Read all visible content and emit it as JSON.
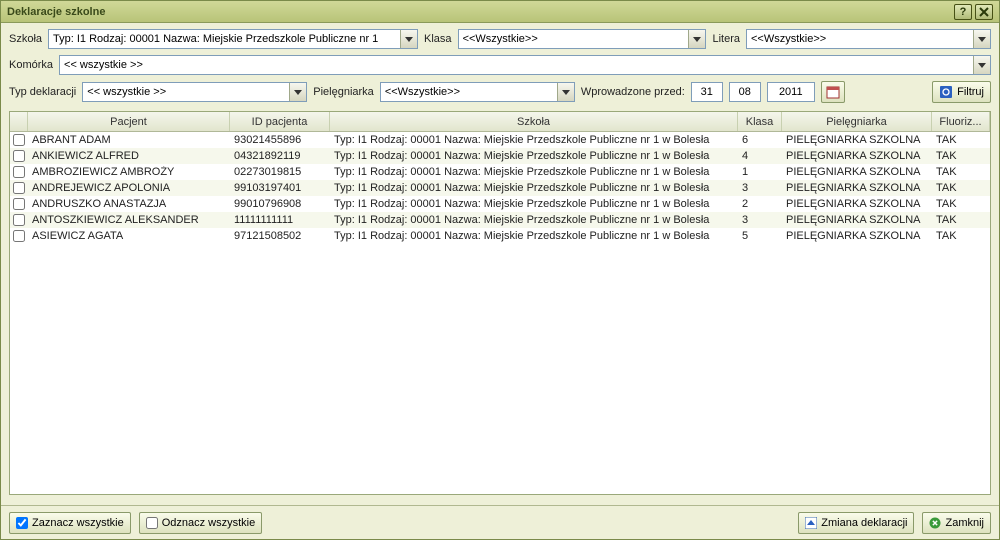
{
  "title": "Deklaracje szkolne",
  "filters": {
    "szkola_label": "Szkoła",
    "szkola_value": "Typ: I1 Rodzaj: 00001 Nazwa: Miejskie Przedszkole Publiczne nr 1",
    "klasa_label": "Klasa",
    "klasa_value": "<<Wszystkie>>",
    "litera_label": "Litera",
    "litera_value": "<<Wszystkie>>",
    "komorka_label": "Komórka",
    "komorka_value": "<< wszystkie >>",
    "typdek_label": "Typ deklaracji",
    "typdek_value": "<< wszystkie >>",
    "pieleg_label": "Pielęgniarka",
    "pieleg_value": "<<Wszystkie>>",
    "wprow_label": "Wprowadzone przed:",
    "day": "31",
    "month": "08",
    "year": "2011",
    "filtruj_label": "Filtruj"
  },
  "columns": {
    "pacjent": "Pacjent",
    "idpac": "ID pacjenta",
    "szkola": "Szkoła",
    "klasa": "Klasa",
    "pieleg": "Pielęgniarka",
    "fluor": "Fluoriz..."
  },
  "rows": [
    {
      "pacjent": "ABRANT ADAM",
      "id": "93021455896",
      "szkola": "Typ: I1 Rodzaj: 00001 Nazwa: Miejskie Przedszkole Publiczne nr 1 w Bolesła",
      "klasa": "6",
      "pieleg": "PIELĘGNIARKA SZKOLNA",
      "fluor": "TAK"
    },
    {
      "pacjent": "ANKIEWICZ ALFRED",
      "id": "04321892119",
      "szkola": "Typ: I1 Rodzaj: 00001 Nazwa: Miejskie Przedszkole Publiczne nr 1 w Bolesła",
      "klasa": "4",
      "pieleg": "PIELĘGNIARKA SZKOLNA",
      "fluor": "TAK"
    },
    {
      "pacjent": "AMBROZIEWICZ AMBROŻY",
      "id": "02273019815",
      "szkola": "Typ: I1 Rodzaj: 00001 Nazwa: Miejskie Przedszkole Publiczne nr 1 w Bolesła",
      "klasa": "1",
      "pieleg": "PIELĘGNIARKA SZKOLNA",
      "fluor": "TAK"
    },
    {
      "pacjent": "ANDREJEWICZ APOLONIA",
      "id": "99103197401",
      "szkola": "Typ: I1 Rodzaj: 00001 Nazwa: Miejskie Przedszkole Publiczne nr 1 w Bolesła",
      "klasa": "3",
      "pieleg": "PIELĘGNIARKA SZKOLNA",
      "fluor": "TAK"
    },
    {
      "pacjent": "ANDRUSZKO ANASTAZJA",
      "id": "99010796908",
      "szkola": "Typ: I1 Rodzaj: 00001 Nazwa: Miejskie Przedszkole Publiczne nr 1 w Bolesła",
      "klasa": "2",
      "pieleg": "PIELĘGNIARKA SZKOLNA",
      "fluor": "TAK"
    },
    {
      "pacjent": "ANTOSZKIEWICZ ALEKSANDER",
      "id": "11111111111",
      "szkola": "Typ: I1 Rodzaj: 00001 Nazwa: Miejskie Przedszkole Publiczne nr 1 w Bolesła",
      "klasa": "3",
      "pieleg": "PIELĘGNIARKA SZKOLNA",
      "fluor": "TAK"
    },
    {
      "pacjent": "ASIEWICZ AGATA",
      "id": "97121508502",
      "szkola": "Typ: I1 Rodzaj: 00001 Nazwa: Miejskie Przedszkole Publiczne nr 1 w Bolesła",
      "klasa": "5",
      "pieleg": "PIELĘGNIARKA SZKOLNA",
      "fluor": "TAK"
    }
  ],
  "footer": {
    "select_all": "Zaznacz wszystkie",
    "deselect_all": "Odznacz wszystkie",
    "zmiana": "Zmiana deklaracji",
    "zamknij": "Zamknij"
  }
}
